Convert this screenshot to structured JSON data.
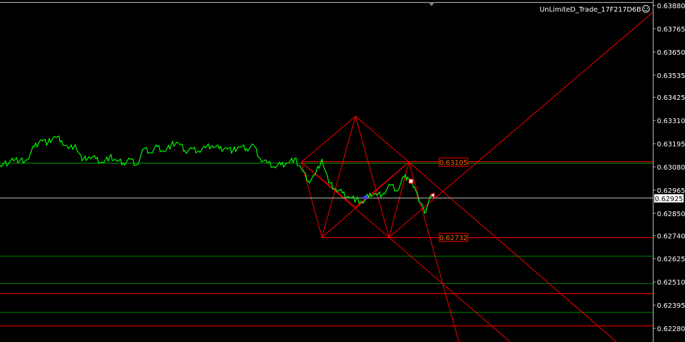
{
  "chart_data": {
    "type": "line",
    "title": "UnLimiteD_Trade_17F217D6B",
    "title_icon": "smiley-icon",
    "ylim": [
      0.6222,
      0.6388
    ],
    "y_ticks": [
      "0.63880",
      "0.63765",
      "0.63650",
      "0.63535",
      "0.63425",
      "0.63310",
      "0.63195",
      "0.63080",
      "0.62965",
      "0.62850",
      "0.62740",
      "0.62625",
      "0.62510",
      "0.62395",
      "0.62280"
    ],
    "current_price": "0.62925",
    "level_high": "0.63105",
    "level_low": "0.62732",
    "grid": false,
    "colors": {
      "background": "#000000",
      "price_line": "#00ff00",
      "pattern": "#ff0000",
      "level_label_bg": "#cc0000",
      "level_label_text": "#ff9900",
      "h_green": "#008000",
      "h_red": "#ff0000",
      "price_marker_line": "#c0c0c0",
      "axis_text": "#ffffff"
    },
    "series": [
      {
        "x": [
          0,
          20,
          40,
          50,
          60,
          70,
          80,
          90,
          100,
          110,
          120,
          130,
          140,
          150,
          160,
          170,
          180,
          190,
          200,
          210,
          220,
          230,
          240,
          250,
          260,
          270,
          280,
          290,
          300,
          310,
          320,
          330,
          340,
          350,
          360,
          370,
          380,
          390,
          400,
          410,
          420,
          430,
          440,
          450,
          460,
          470,
          480,
          490,
          500,
          510,
          520,
          530,
          540,
          550,
          560,
          570,
          580,
          590,
          595,
          600,
          605,
          610,
          615,
          620,
          625,
          630
        ],
        "values": [
          0.6309,
          0.6311,
          0.63115,
          0.6318,
          0.63215,
          0.632,
          0.6323,
          0.6321,
          0.6317,
          0.6319,
          0.6311,
          0.6313,
          0.6312,
          0.631,
          0.6313,
          0.6311,
          0.631,
          0.6312,
          0.6309,
          0.6317,
          0.6315,
          0.6318,
          0.63155,
          0.6319,
          0.632,
          0.6316,
          0.6317,
          0.6316,
          0.63175,
          0.63185,
          0.6317,
          0.63175,
          0.6316,
          0.6318,
          0.6317,
          0.6319,
          0.6312,
          0.631,
          0.6308,
          0.6309,
          0.631,
          0.6312,
          0.6307,
          0.6301,
          0.6304,
          0.6312,
          0.63,
          0.6297,
          0.6295,
          0.6293,
          0.6292,
          0.629,
          0.6295,
          0.6294,
          0.6295,
          0.6299,
          0.6296,
          0.6303,
          0.6303,
          0.6301,
          0.6298,
          0.6293,
          0.629,
          0.6285,
          0.629,
          0.6293
        ]
      }
    ]
  }
}
